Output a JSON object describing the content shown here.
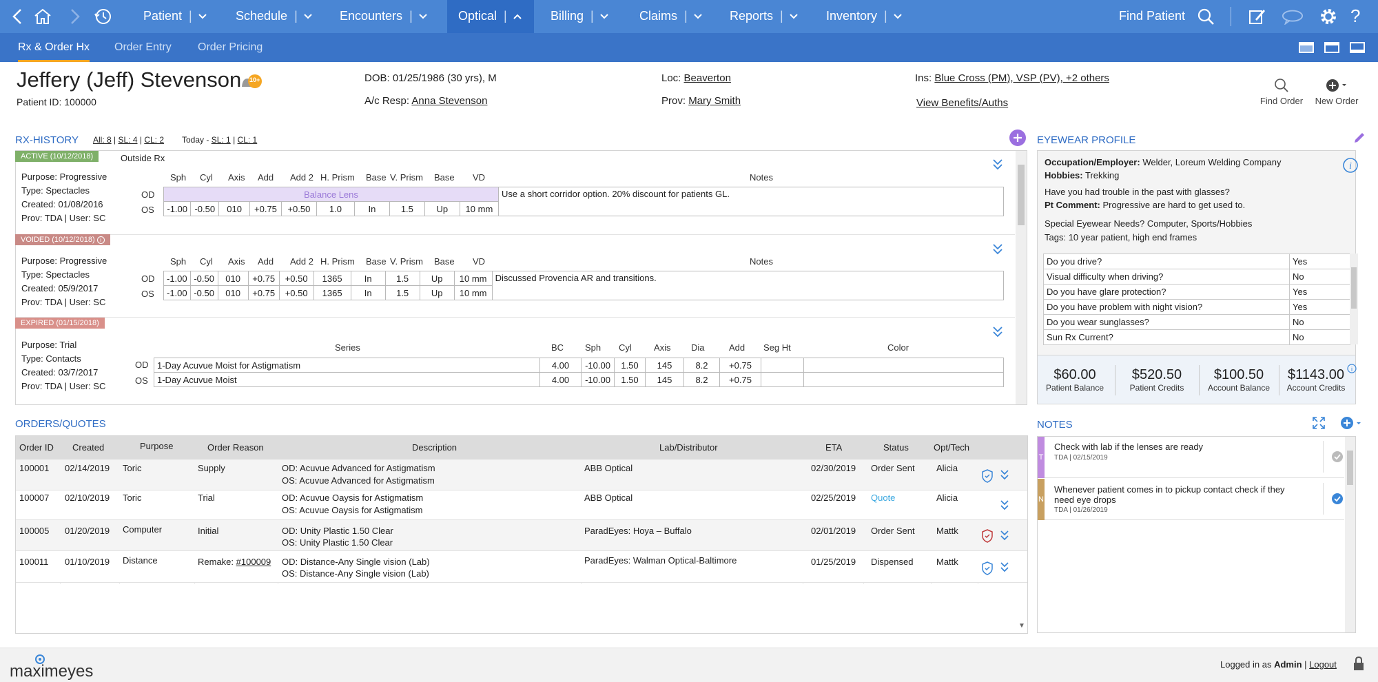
{
  "nav": {
    "items": [
      {
        "label": "Patient"
      },
      {
        "label": "Schedule"
      },
      {
        "label": "Encounters"
      },
      {
        "label": "Optical"
      },
      {
        "label": "Billing"
      },
      {
        "label": "Claims"
      },
      {
        "label": "Reports"
      },
      {
        "label": "Inventory"
      }
    ],
    "find_patient": "Find Patient"
  },
  "subnav": {
    "tabs": [
      {
        "label": "Rx & Order Hx"
      },
      {
        "label": "Order Entry"
      },
      {
        "label": "Order Pricing"
      }
    ]
  },
  "patient": {
    "name": "Jeffery (Jeff) Stevenson",
    "badge": "10+",
    "id_label": "Patient ID: 100000",
    "dob": "DOB: 01/25/1986 (30 yrs), M",
    "acresp_label": "A/c Resp:",
    "acresp": "Anna Stevenson",
    "loc_label": "Loc:",
    "loc": "Beaverton",
    "prov_label": "Prov:",
    "prov": "Mary Smith",
    "ins_label": "Ins:",
    "ins": "Blue Cross (PM), VSP (PV), +2 others",
    "benefits": "View Benefits/Auths",
    "find_order": "Find Order",
    "new_order": "New Order"
  },
  "rx_history": {
    "title": "RX-HISTORY",
    "filter_all": "All: 8",
    "filter_sl": "SL: 4",
    "filter_cl": "CL: 2",
    "today": "Today -",
    "today_sl": "SL: 1",
    "today_cl": "CL: 1",
    "outside_rx": "Outside Rx",
    "spec_headers": [
      "Sph",
      "Cyl",
      "Axis",
      "Add",
      "Add 2",
      "H. Prism",
      "Base",
      "V. Prism",
      "Base",
      "VD"
    ],
    "notes_header": "Notes",
    "rx1": {
      "status": "ACTIVE (10/12/2018)",
      "purpose": "Purpose: Progressive",
      "type": "Type: Spectacles",
      "created": "Created: 01/08/2016",
      "prov": "Prov: TDA | User: SC",
      "od_balance": "Balance Lens",
      "os": [
        "-1.00",
        "-0.50",
        "010",
        "+0.75",
        "+0.50",
        "1.0",
        "In",
        "1.5",
        "Up",
        "10 mm"
      ],
      "note": "Use a short corridor option. 20% discount for patients GL."
    },
    "rx2": {
      "status": "VOIDED (10/12/2018)",
      "purpose": "Purpose: Progressive",
      "type": "Type: Spectacles",
      "created": "Created: 05/9/2017",
      "prov": "Prov: TDA | User: SC",
      "od": [
        "-1.00",
        "-0.50",
        "010",
        "+0.75",
        "+0.50",
        "1365",
        "In",
        "1.5",
        "Up",
        "10 mm"
      ],
      "os": [
        "-1.00",
        "-0.50",
        "010",
        "+0.75",
        "+0.50",
        "1365",
        "In",
        "1.5",
        "Up",
        "10 mm"
      ],
      "note": "Discussed Provencia AR and transitions."
    },
    "rx3": {
      "status": "EXPIRED (01/15/2018)",
      "purpose": "Purpose: Trial",
      "type": "Type: Contacts",
      "created": "Created: 03/7/2017",
      "prov": "Prov: TDA | User: SC",
      "headers": [
        "Series",
        "BC",
        "Sph",
        "Cyl",
        "Axis",
        "Dia",
        "Add",
        "Seg Ht",
        "Color"
      ],
      "od": [
        "1-Day Acuvue Moist for Astigmatism",
        "4.00",
        "-10.00",
        "1.50",
        "145",
        "8.2",
        "+0.75"
      ],
      "os": [
        "1-Day Acuvue Moist",
        "4.00",
        "-10.00",
        "1.50",
        "145",
        "8.2",
        "+0.75"
      ]
    },
    "od_label": "OD",
    "os_label": "OS"
  },
  "orders": {
    "title": "ORDERS/QUOTES",
    "headers": [
      "Order ID",
      "Created",
      "Purpose",
      "Order Reason",
      "Description",
      "Lab/Distributor",
      "ETA",
      "Status",
      "Opt/Tech"
    ],
    "rows": [
      {
        "id": "100001",
        "created": "02/14/2019",
        "purpose": "Toric",
        "reason": "Supply",
        "desc1": "OD: Acuvue Advanced for Astigmatism",
        "desc2": "OS: Acuvue Advanced for Astigmatism",
        "lab": "ABB Optical",
        "eta": "02/30/2019",
        "status": "Order Sent",
        "tech": "Alicia"
      },
      {
        "id": "100007",
        "created": "02/10/2019",
        "purpose": "Toric",
        "reason": "Trial",
        "desc1": "OD: Acuvue Oaysis for Astigmatism",
        "desc2": "OS: Acuvue Oaysis for Astigmatism",
        "lab": "ABB Optical",
        "eta": "02/25/2019",
        "status": "Quote",
        "tech": "Alicia"
      },
      {
        "id": "100005",
        "created": "01/20/2019",
        "purpose": "Computer",
        "reason": "Initial",
        "desc1": "OD: Unity Plastic 1.50 Clear",
        "desc2": "OS: Unity Plastic 1.50 Clear",
        "lab": "ParadEyes: Hoya – Buffalo",
        "eta": "02/01/2019",
        "status": "Order Sent",
        "tech": "Mattk"
      },
      {
        "id": "100011",
        "created": "01/10/2019",
        "purpose": "Distance",
        "reason": "Remake:",
        "reason_link": "#100009",
        "desc1": "OD: Distance-Any Single vision (Lab)",
        "desc2": "OS: Distance-Any Single vision (Lab)",
        "lab": "ParadEyes: Walman Optical-Baltimore",
        "eta": "01/25/2019",
        "status": "Dispensed",
        "tech": "Mattk"
      }
    ],
    "colors": {
      "quote": "#3aa8e0"
    }
  },
  "eyewear": {
    "title": "EYEWEAR PROFILE",
    "occ_label": "Occupation/Employer:",
    "occ": "Welder, Loreum Welding Company",
    "hobbies_label": "Hobbies:",
    "hobbies": "Trekking",
    "q_trouble": "Have you had trouble in the past with glasses?",
    "pt_comment_label": "Pt Comment:",
    "pt_comment": "Progressive are hard to get used to.",
    "special": "Special Eyewear Needs?  Computer, Sports/Hobbies",
    "tags_label": "Tags:",
    "tags": "10 year patient, high end frames",
    "questions": [
      {
        "q": "Do you drive?",
        "a": "Yes"
      },
      {
        "q": "Visual difficulty when driving?",
        "a": "No"
      },
      {
        "q": "Do you have glare protection?",
        "a": "Yes"
      },
      {
        "q": "Do you have problem with night vision?",
        "a": "Yes"
      },
      {
        "q": "Do you wear sunglasses?",
        "a": "No"
      },
      {
        "q": "Sun Rx Current?",
        "a": "No"
      }
    ],
    "balances": [
      {
        "amt": "$60.00",
        "lbl": "Patient Balance"
      },
      {
        "amt": "$520.50",
        "lbl": "Patient Credits"
      },
      {
        "amt": "$100.50",
        "lbl": "Account Balance"
      },
      {
        "amt": "$1143.00",
        "lbl": "Account Credits"
      }
    ]
  },
  "notes": {
    "title": "NOTES",
    "items": [
      {
        "text": "Check with lab if the lenses are ready",
        "meta": "TDA | 02/15/2019",
        "tag": "T",
        "tag_color": "#c08ce0"
      },
      {
        "text1": "Whenever patient comes in to pickup contact check if they",
        "text2": "need eye drops",
        "meta": "TDA | 01/26/2019",
        "tag": "N",
        "tag_color": "#c8a060"
      }
    ]
  },
  "footer": {
    "logo": "maximeyes",
    "logged_prefix": "Logged in as",
    "user": "Admin",
    "logout": "Logout"
  }
}
